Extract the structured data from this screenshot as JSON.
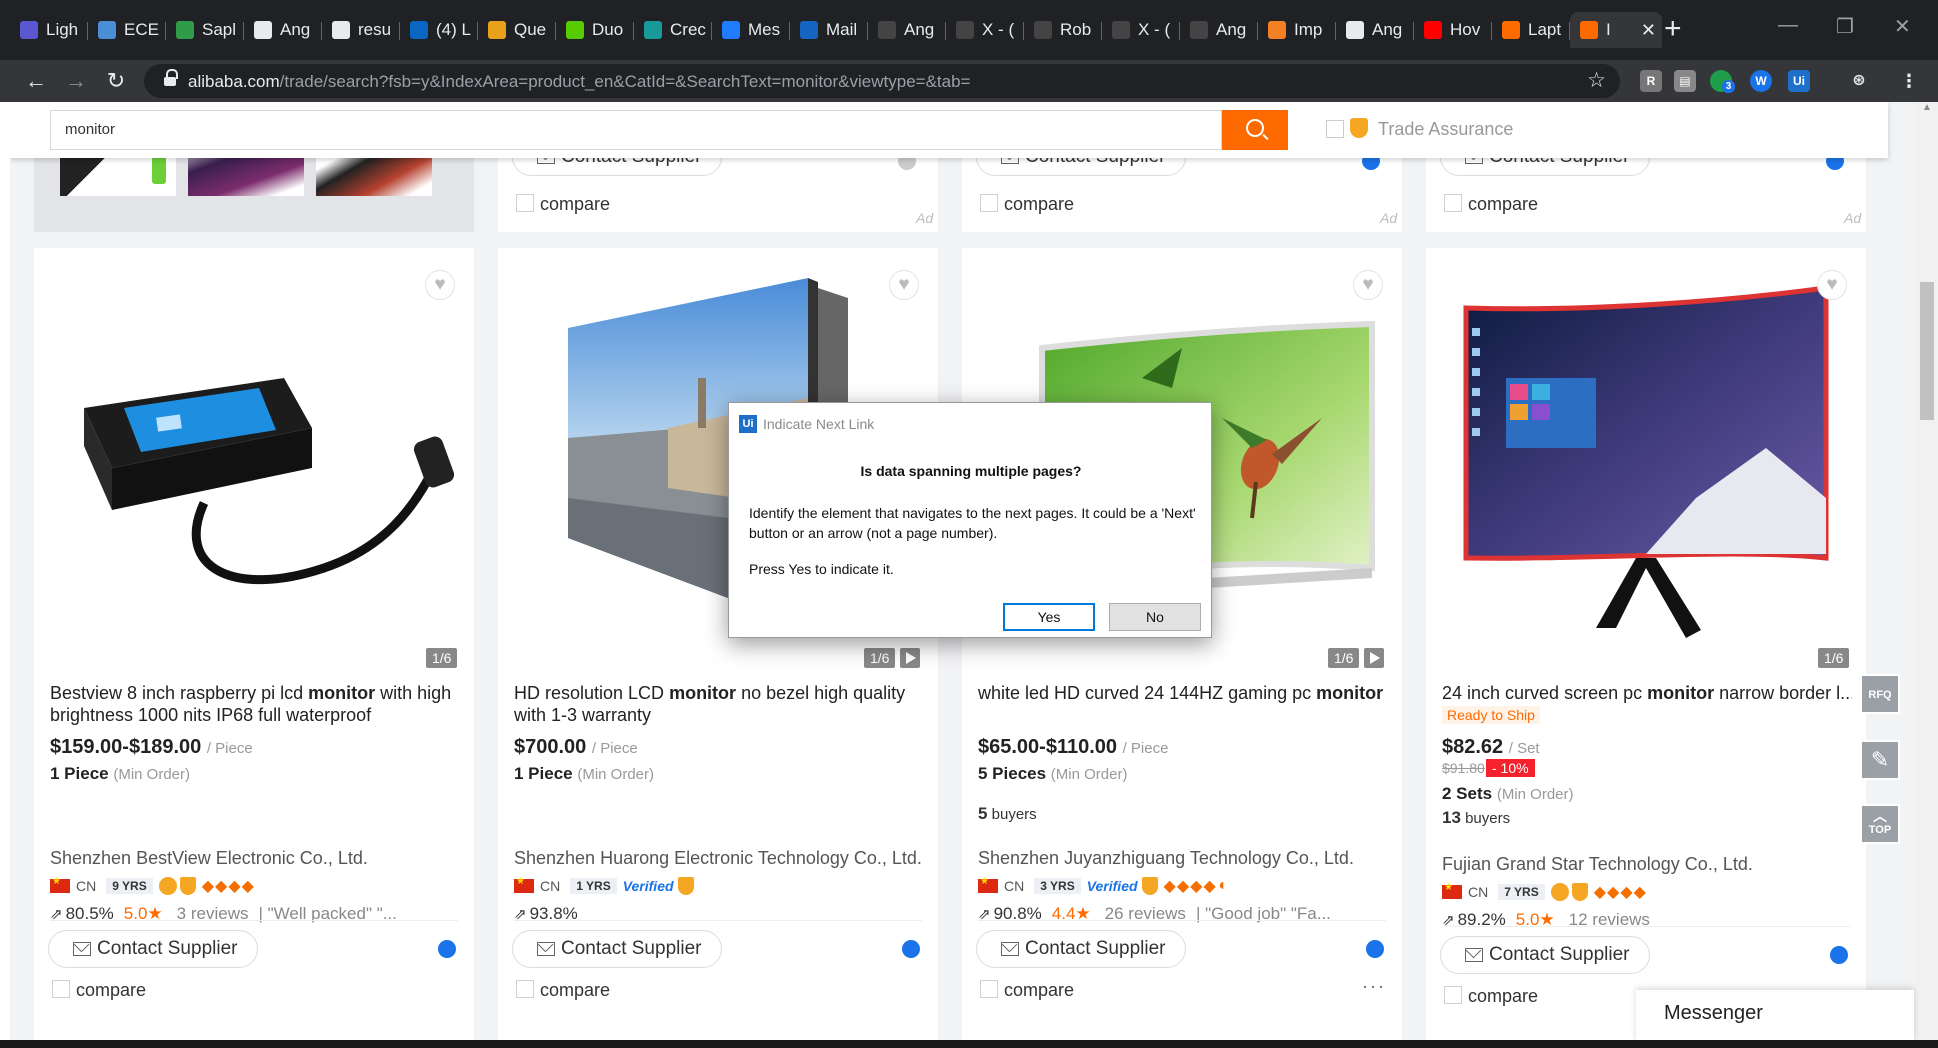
{
  "browser": {
    "tabs": [
      {
        "label": "Ligh",
        "icon": "list-icon",
        "color": "#5b57d1"
      },
      {
        "label": "ECE",
        "icon": "p-icon",
        "color": "#4a8fd6"
      },
      {
        "label": "Sapl",
        "icon": "sapling-icon",
        "color": "#2e9c4a"
      },
      {
        "label": "Ang",
        "icon": "globe-icon",
        "color": "#e8eaed"
      },
      {
        "label": "resu",
        "icon": "globe-icon",
        "color": "#e8eaed"
      },
      {
        "label": "(4) L",
        "icon": "linkedin-icon",
        "color": "#0a66c2"
      },
      {
        "label": "Que",
        "icon": "quora-icon",
        "color": "#e8a11a"
      },
      {
        "label": "Duo",
        "icon": "duo-icon",
        "color": "#58cc02"
      },
      {
        "label": "Crec",
        "icon": "c-icon",
        "color": "#199a9a"
      },
      {
        "label": "Mes",
        "icon": "messenger-icon",
        "color": "#1f7cff"
      },
      {
        "label": "Mail",
        "icon": "mail-icon",
        "color": "#1565c0"
      },
      {
        "label": "Ang",
        "icon": "github-icon",
        "color": "#444"
      },
      {
        "label": "X - (",
        "icon": "x-icon",
        "color": "#444"
      },
      {
        "label": "Rob",
        "icon": "x-icon",
        "color": "#444"
      },
      {
        "label": "X - (",
        "icon": "x-icon",
        "color": "#444"
      },
      {
        "label": "Ang",
        "icon": "github-icon",
        "color": "#444"
      },
      {
        "label": "Imp",
        "icon": "stack-icon",
        "color": "#f48024"
      },
      {
        "label": "Ang",
        "icon": "globe-icon",
        "color": "#e8eaed"
      },
      {
        "label": "Hov",
        "icon": "youtube-icon",
        "color": "#ff0000"
      },
      {
        "label": "Lapt",
        "icon": "alibaba-icon",
        "color": "#ff6a00"
      },
      {
        "label": "I",
        "icon": "alibaba-icon",
        "color": "#ff6a00"
      }
    ],
    "url_host": "alibaba.com",
    "url_path": "/trade/search?fsb=y&IndexArea=product_en&CatId=&SearchText=monitor&viewtype=&tab=",
    "extension_badge": "3"
  },
  "search": {
    "value": "monitor",
    "trade_assurance": "Trade Assurance"
  },
  "top_row": {
    "contact_label": "Contact Supplier",
    "compare_label": "compare",
    "ad_label": "Ad"
  },
  "products": [
    {
      "title_pre": "Bestview 8 inch raspberry pi lcd ",
      "title_kw": "monitor",
      "title_post": " with high brightness 1000 nits IP68 full waterproof",
      "counter": "1/6",
      "price": "$159.00-$189.00",
      "unit": "/ Piece",
      "moq": "1 Piece",
      "moq_note": "(Min Order)",
      "buyers_n": "",
      "buyers_label": "",
      "supplier": "Shenzhen BestView Electronic Co., Ltd.",
      "country": "CN",
      "years": "9 YRS",
      "response": "80.5%",
      "rating": "5.0",
      "reviews": "3 reviews",
      "review_note": "| \"Well packed\"   \"...",
      "contact": "Contact Supplier",
      "compare": "compare"
    },
    {
      "title_pre": "HD resolution LCD ",
      "title_kw": "monitor",
      "title_post": " no bezel high quality with 1-3 warranty",
      "counter": "1/6",
      "price": "$700.00",
      "unit": "/ Piece",
      "moq": "1 Piece",
      "moq_note": "(Min Order)",
      "buyers_n": "",
      "buyers_label": "",
      "supplier": "Shenzhen Huarong Electronic Technology Co., Ltd.",
      "country": "CN",
      "years": "1 YRS",
      "verified": "Verified",
      "response": "93.8%",
      "contact": "Contact Supplier",
      "compare": "compare"
    },
    {
      "title_pre": "white led HD curved 24 144HZ gaming pc ",
      "title_kw": "monitor",
      "title_post": "",
      "counter": "1/6",
      "price": "$65.00-$110.00",
      "unit": "/ Piece",
      "moq": "5 Pieces",
      "moq_note": "(Min Order)",
      "buyers_n": "5",
      "buyers_label": " buyers",
      "supplier": "Shenzhen Juyanzhiguang Technology Co., Ltd.",
      "country": "CN",
      "years": "3 YRS",
      "verified": "Verified",
      "response": "90.8%",
      "rating": "4.4",
      "reviews": "26 reviews",
      "review_note": "| \"Good job\"   \"Fa...",
      "contact": "Contact Supplier",
      "compare": "compare"
    },
    {
      "title_pre": "24 inch curved screen pc ",
      "title_kw": "monitor",
      "title_post": " narrow border l...",
      "ready": "Ready to Ship",
      "counter": "1/6",
      "price": "$82.62",
      "unit": "/ Set",
      "old_price": "$91.80",
      "discount": "- 10%",
      "moq": "2 Sets",
      "moq_note": "(Min Order)",
      "buyers_n": "13",
      "buyers_label": " buyers",
      "supplier": "Fujian Grand Star Technology Co., Ltd.",
      "country": "CN",
      "years": "7 YRS",
      "response": "89.2%",
      "rating": "5.0",
      "reviews": "12 reviews",
      "contact": "Contact Supplier",
      "compare": "compare"
    }
  ],
  "side_tools": {
    "rfq": "RFQ",
    "top": "TOP"
  },
  "messenger": "Messenger",
  "dialog": {
    "title": "Indicate Next Link",
    "icon_text": "Ui",
    "heading": "Is data spanning multiple pages?",
    "body": "Identify the element that navigates to the next pages. It could be a 'Next' button or an arrow (not a page number).",
    "press": "Press Yes to indicate it.",
    "yes": "Yes",
    "no": "No"
  }
}
